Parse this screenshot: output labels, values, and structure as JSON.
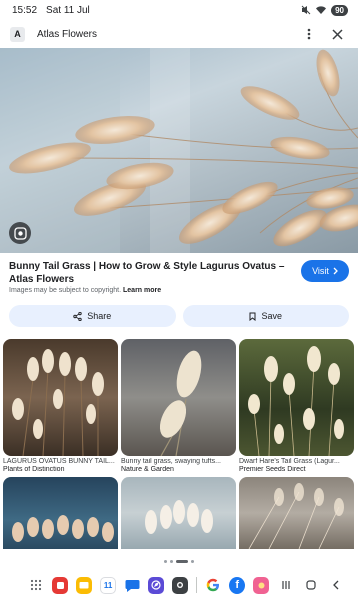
{
  "status_bar": {
    "time": "15:52",
    "date": "Sat 11 Jul",
    "battery": "90"
  },
  "header": {
    "site_logo": "A",
    "site_name": "Atlas Flowers",
    "menu_icon": "more-vert-icon",
    "close_icon": "close-icon"
  },
  "hero": {
    "image_icon": "bunny-tail-grass-photo",
    "lens_icon": "google-lens-icon"
  },
  "result": {
    "title": "Bunny Tail Grass | How to Grow & Style Lagurus Ovatus – Atlas Flowers",
    "copyright_text": "Images may be subject to copyright.",
    "learn_more": "Learn more",
    "visit_label": "Visit"
  },
  "actions": {
    "share_label": "Share",
    "save_label": "Save"
  },
  "grid": {
    "items": [
      {
        "title": "LAGURUS OVATUS BUNNY TAIL...",
        "source": "Plants of Distinction"
      },
      {
        "title": "Bunny tail grass, swaying tufts...",
        "source": "Nature & Garden"
      },
      {
        "title": "Dwarf Hare's Tail Grass (Lagur...",
        "source": "Premier Seeds Direct"
      }
    ]
  },
  "navbar": {
    "calendar_day": "11",
    "apps": [
      "app-drawer-icon",
      "app-icon-red",
      "files-icon",
      "calendar-icon",
      "messages-icon",
      "browser-icon",
      "camera-icon",
      "google-icon",
      "facebook-icon",
      "app-icon-pink"
    ],
    "colors": {
      "accent": "#1a73e8",
      "action_bg": "#e8f0fe"
    }
  }
}
